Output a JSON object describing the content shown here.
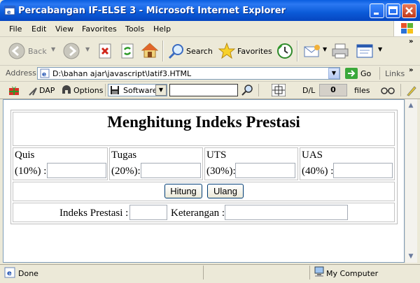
{
  "window": {
    "title": "Percabangan IF-ELSE 3 - Microsoft Internet Explorer"
  },
  "menu": [
    "File",
    "Edit",
    "View",
    "Favorites",
    "Tools",
    "Help"
  ],
  "toolbar": {
    "back": "Back",
    "search": "Search",
    "favorites": "Favorites"
  },
  "address": {
    "label": "Address",
    "url": "D:\\bahan ajar\\javascript\\latif3.HTML",
    "go": "Go",
    "links": "Links"
  },
  "linkbar": {
    "dap": "DAP",
    "options": "Options",
    "software": "Software",
    "dl": "D/L",
    "count": "0",
    "files": "files"
  },
  "page": {
    "heading": "Menghitung Indeks Prestasi",
    "fields": [
      {
        "name": "Quis",
        "weight": "(10%) :"
      },
      {
        "name": "Tugas",
        "weight": "(20%):"
      },
      {
        "name": "UTS",
        "weight": "(30%):"
      },
      {
        "name": "UAS",
        "weight": "(40%) :"
      }
    ],
    "hitung": "Hitung",
    "ulang": "Ulang",
    "ip_label": "Indeks Prestasi :",
    "keterangan_label": "Keterangan :"
  },
  "status": {
    "left": "Done",
    "zone": "My Computer"
  }
}
